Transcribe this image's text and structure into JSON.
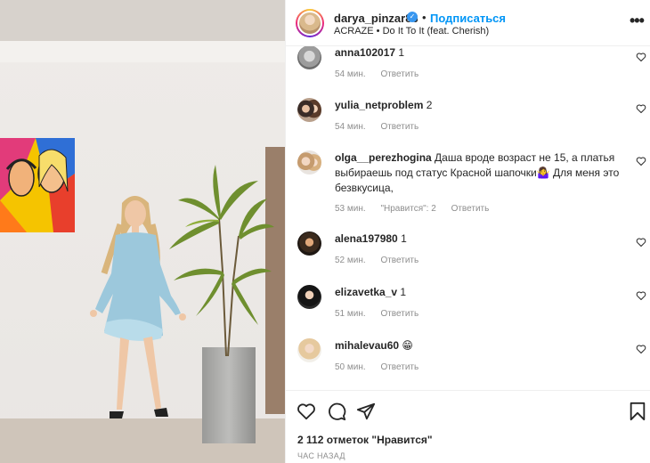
{
  "header": {
    "username": "darya_pinzar86",
    "separator": "•",
    "follow_label": "Подписаться",
    "song": "ACRAZE • Do It To It (feat. Cherish)",
    "more_label": "•••"
  },
  "comments": [
    {
      "username": "anna102017",
      "text": "1",
      "time": "54 мин.",
      "likes": "",
      "reply": "Ответить"
    },
    {
      "username": "yulia_netproblem",
      "text": "2",
      "time": "54 мин.",
      "likes": "",
      "reply": "Ответить"
    },
    {
      "username": "olga__perezhogina",
      "text": "Даша вроде возраст не 15, а платья выбираешь под статус Красной шапочки🤷‍♀️ Для меня это безвкусица,",
      "time": "53 мин.",
      "likes": "\"Нравится\": 2",
      "reply": "Ответить"
    },
    {
      "username": "alena197980",
      "text": "1",
      "time": "52 мин.",
      "likes": "",
      "reply": "Ответить"
    },
    {
      "username": "elizavetka_v",
      "text": "1",
      "time": "51 мин.",
      "likes": "",
      "reply": "Ответить"
    },
    {
      "username": "mihalevau60",
      "text": "😁",
      "time": "50 мин.",
      "likes": "",
      "reply": "Ответить"
    }
  ],
  "footer": {
    "likes": "2 112 отметок \"Нравится\"",
    "time": "час назад"
  },
  "colors": {
    "accent": "#0095f6",
    "text": "#262626",
    "muted": "#8e8e8e",
    "verified": "#3897f0"
  },
  "icons": {
    "verified": "verified-badge-icon",
    "more": "more-options-icon",
    "comment_like": "heart-outline-icon",
    "like": "heart-icon",
    "comment": "comment-bubble-icon",
    "share": "paper-plane-icon",
    "save": "bookmark-icon"
  }
}
